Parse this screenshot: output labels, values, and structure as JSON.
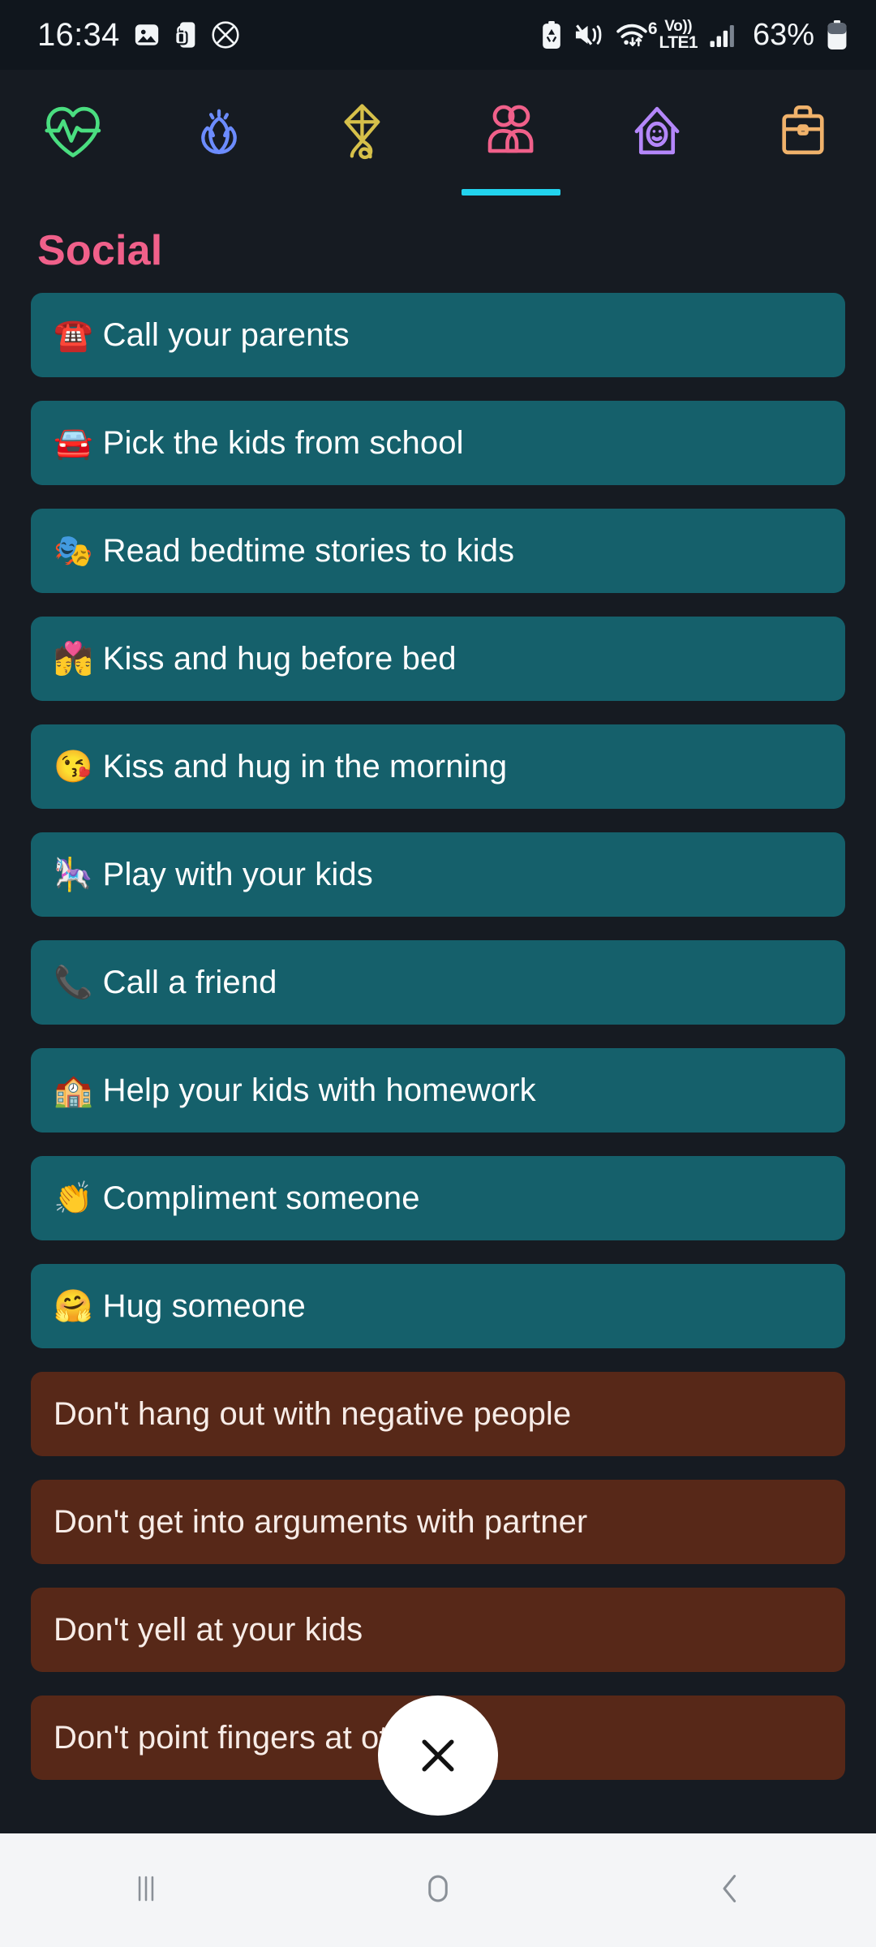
{
  "status_bar": {
    "time": "16:34",
    "left_icons": [
      "image-icon",
      "phone-lock-icon",
      "no-sim-slash-icon"
    ],
    "right_icons": [
      "battery-saver-icon",
      "mute-icon",
      "wifi-6-icon",
      "volte-lte1-icon",
      "signal-bars-icon"
    ],
    "wifi_label": "6",
    "network_top": "Vo))",
    "network_bottom": "LTE1",
    "battery_percent": "63%"
  },
  "tabs": [
    {
      "name": "health",
      "icon": "heartbeat-icon",
      "color": "#4ade80",
      "active": false
    },
    {
      "name": "mindfulness",
      "icon": "lotus-icon",
      "color": "#6c8cff",
      "active": false
    },
    {
      "name": "hobby",
      "icon": "kite-icon",
      "color": "#d6c04a",
      "active": false
    },
    {
      "name": "social",
      "icon": "two-people-icon",
      "color": "#f0608a",
      "active": true
    },
    {
      "name": "home",
      "icon": "house-smile-icon",
      "color": "#b487fa",
      "active": false
    },
    {
      "name": "work",
      "icon": "briefcase-icon",
      "color": "#f0b26b",
      "active": false
    }
  ],
  "accent": {
    "title_pink": "#f0608a",
    "tab_indicator": "#22d3ee",
    "positive_card": "#15606b",
    "negative_card": "#572818",
    "screen_bg": "#161b22"
  },
  "main": {
    "title": "Social",
    "items": [
      {
        "emoji": "☎️",
        "emoji_name": "telephone-icon",
        "label": "Call your parents",
        "type": "positive"
      },
      {
        "emoji": "🚘",
        "emoji_name": "car-icon",
        "label": "Pick the kids from school",
        "type": "positive"
      },
      {
        "emoji": "🎭",
        "emoji_name": "performing-arts-icon",
        "label": "Read bedtime stories to kids",
        "type": "positive"
      },
      {
        "emoji": "💏",
        "emoji_name": "kiss-couple-icon",
        "label": "Kiss and hug before bed",
        "type": "positive"
      },
      {
        "emoji": "😘",
        "emoji_name": "kissing-face-icon",
        "label": "Kiss and hug in the morning",
        "type": "positive"
      },
      {
        "emoji": "🎠",
        "emoji_name": "carousel-horse-icon",
        "label": "Play with your kids",
        "type": "positive"
      },
      {
        "emoji": "📞",
        "emoji_name": "phone-receiver-icon",
        "label": "Call a friend",
        "type": "positive"
      },
      {
        "emoji": "🏫",
        "emoji_name": "school-icon",
        "label": "Help your kids with homework",
        "type": "positive"
      },
      {
        "emoji": "👏",
        "emoji_name": "clapping-hands-icon",
        "label": "Compliment someone",
        "type": "positive"
      },
      {
        "emoji": "🤗",
        "emoji_name": "hugging-face-icon",
        "label": "Hug someone",
        "type": "positive"
      },
      {
        "emoji": "",
        "emoji_name": "",
        "label": "Don't hang out with negative people",
        "type": "negative"
      },
      {
        "emoji": "",
        "emoji_name": "",
        "label": "Don't get into arguments with partner",
        "type": "negative"
      },
      {
        "emoji": "",
        "emoji_name": "",
        "label": "Don't yell at your kids",
        "type": "negative"
      },
      {
        "emoji": "",
        "emoji_name": "",
        "label": "Don't point fingers at others",
        "type": "negative"
      }
    ]
  },
  "fab": {
    "icon": "close-x-icon",
    "label": "×"
  },
  "nav_bar": {
    "buttons": [
      {
        "name": "recents-button",
        "icon": "recents-icon"
      },
      {
        "name": "home-button",
        "icon": "home-icon"
      },
      {
        "name": "back-button",
        "icon": "back-chevron-icon"
      }
    ]
  }
}
